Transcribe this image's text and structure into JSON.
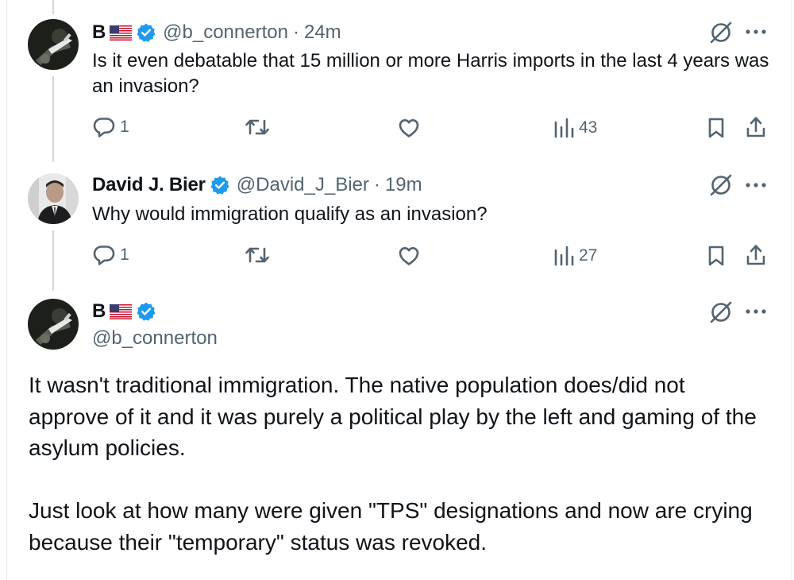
{
  "colors": {
    "text": "#0f1419",
    "muted": "#536471",
    "verified": "#1d9bf0",
    "thread": "#cfd9de"
  },
  "tweet1": {
    "name": "B",
    "handle": "@b_connerton",
    "sep": "·",
    "time": "24m",
    "text": "Is it even debatable that 15 million or more Harris imports in the last 4 years was an invasion?",
    "replies": "1",
    "views": "43",
    "flag": "us-flag",
    "verified_icon": "verified-badge-icon"
  },
  "tweet2": {
    "name": "David J. Bier",
    "handle": "@David_J_Bier",
    "sep": "·",
    "time": "19m",
    "text": "Why would immigration qualify as an invasion?",
    "replies": "1",
    "views": "27",
    "verified_icon": "verified-badge-icon"
  },
  "tweet3": {
    "name": "B",
    "handle": "@b_connerton",
    "flag": "us-flag",
    "paragraph1": "It wasn't traditional immigration. The native population does/did not approve of it and it was purely a political play by the left and gaming of the asylum policies.",
    "paragraph2": "Just look at how many were given \"TPS\" designations and now are crying because their \"temporary\" status was revoked."
  },
  "icons": [
    "reply-icon",
    "retweet-icon",
    "like-icon",
    "views-icon",
    "bookmark-icon",
    "share-icon",
    "grok-icon",
    "more-icon"
  ]
}
